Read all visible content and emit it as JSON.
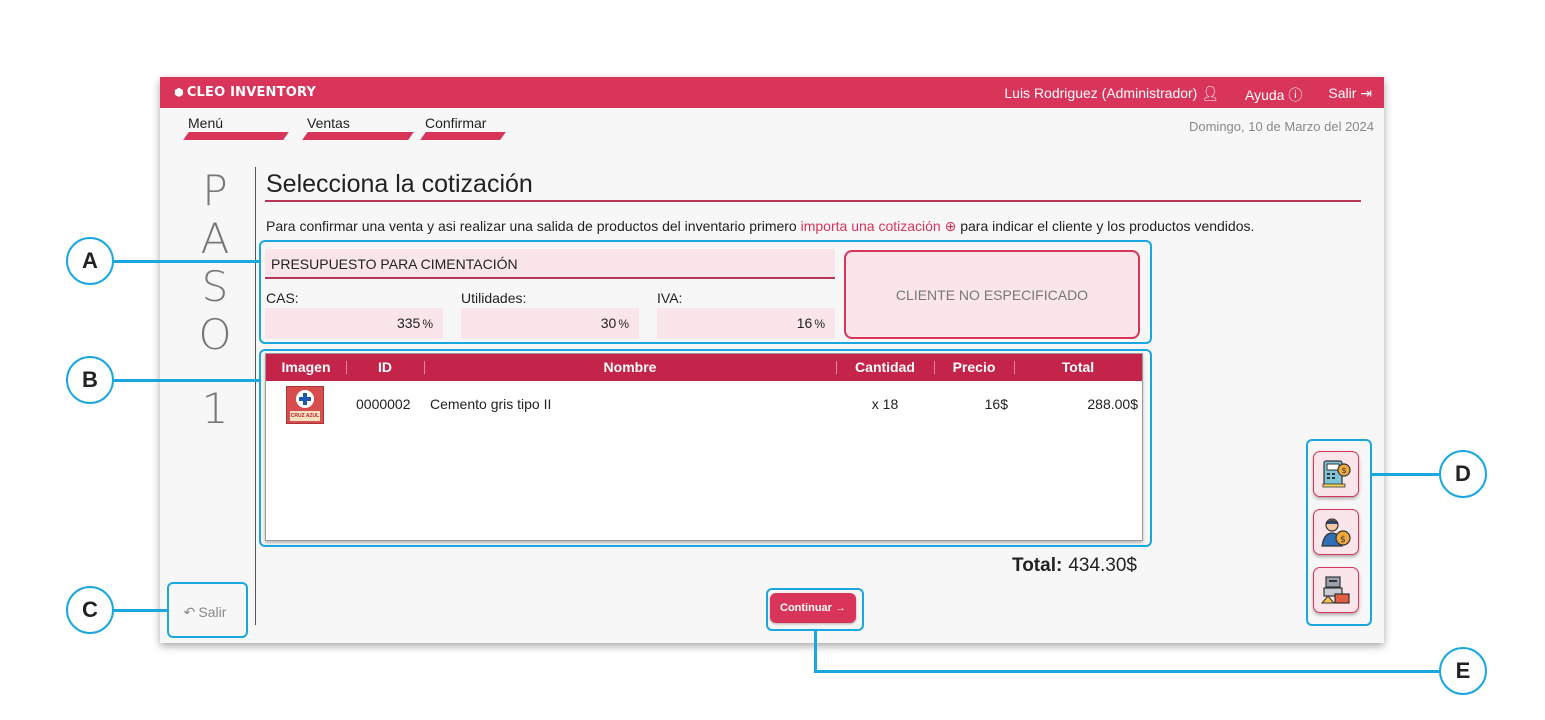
{
  "app": {
    "brand": "CLEO INVENTORY",
    "accent_color": "#d9345a"
  },
  "topnav": {
    "user": "Luis Rodriguez (Administrador)",
    "help": "Ayuda",
    "logout": "Salir"
  },
  "tabs": [
    {
      "label": "Menú"
    },
    {
      "label": "Ventas"
    },
    {
      "label": "Confirmar"
    }
  ],
  "date": "Domingo, 10 de Marzo del 2024",
  "step": {
    "letters": [
      "P",
      "A",
      "S",
      "O",
      "1"
    ]
  },
  "exit_label": "Salir",
  "main": {
    "title": "Selecciona la cotización",
    "description_before": "Para confirmar una venta y asi realizar una salida de productos del inventario primero ",
    "description_link": "importa una cotización",
    "description_after": " para indicar el cliente y los productos vendidos."
  },
  "quote": {
    "name": "PRESUPUESTO PARA CIMENTACIÓN",
    "fields": [
      {
        "label": "CAS:",
        "value": "335",
        "unit": "%"
      },
      {
        "label": "Utilidades:",
        "value": "30",
        "unit": "%"
      },
      {
        "label": "IVA:",
        "value": "16",
        "unit": "%"
      }
    ],
    "client": "CLIENTE NO ESPECIFICADO"
  },
  "table": {
    "headers": [
      "Imagen",
      "ID",
      "Nombre",
      "Cantidad",
      "Precio",
      "Total"
    ],
    "rows": [
      {
        "image_label": "CRUZ AZUL",
        "id": "0000002",
        "name": "Cemento gris tipo II",
        "quantity": "x 18",
        "price": "16$",
        "total": "288.00$"
      }
    ]
  },
  "summary": {
    "total_label": "Total:",
    "total_value": "434.30$"
  },
  "continue_label": "Continuar →",
  "side_buttons": [
    "quote-machine-icon",
    "customer-money-icon",
    "inventory-boxes-icon"
  ],
  "callouts": [
    "A",
    "B",
    "C",
    "D",
    "E"
  ]
}
